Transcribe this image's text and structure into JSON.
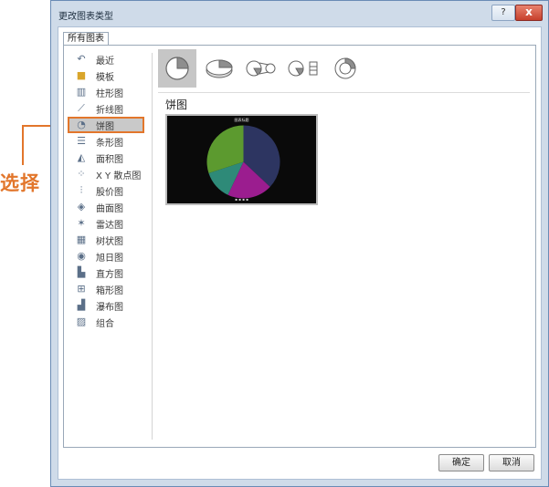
{
  "annotation": {
    "text": "选择",
    "color": "#e2762b"
  },
  "window": {
    "title": "更改图表类型",
    "help_glyph": "?",
    "close_glyph": "x"
  },
  "tab": {
    "label": "所有图表"
  },
  "sidebar": {
    "items": [
      {
        "label": "最近",
        "icon": "recent-icon"
      },
      {
        "label": "模板",
        "icon": "folder-icon"
      },
      {
        "label": "柱形图",
        "icon": "column-chart-icon"
      },
      {
        "label": "折线图",
        "icon": "line-chart-icon"
      },
      {
        "label": "饼图",
        "icon": "pie-chart-icon",
        "selected": true
      },
      {
        "label": "条形图",
        "icon": "bar-chart-icon"
      },
      {
        "label": "面积图",
        "icon": "area-chart-icon"
      },
      {
        "label": "X Y 散点图",
        "icon": "scatter-chart-icon"
      },
      {
        "label": "股价图",
        "icon": "stock-chart-icon"
      },
      {
        "label": "曲面图",
        "icon": "surface-chart-icon"
      },
      {
        "label": "雷达图",
        "icon": "radar-chart-icon"
      },
      {
        "label": "树状图",
        "icon": "treemap-chart-icon"
      },
      {
        "label": "旭日图",
        "icon": "sunburst-chart-icon"
      },
      {
        "label": "直方图",
        "icon": "histogram-chart-icon"
      },
      {
        "label": "箱形图",
        "icon": "box-whisker-chart-icon"
      },
      {
        "label": "瀑布图",
        "icon": "waterfall-chart-icon"
      },
      {
        "label": "组合",
        "icon": "combo-chart-icon"
      }
    ]
  },
  "main": {
    "subtypes": [
      "pie-icon",
      "3d-pie-icon",
      "pie-of-pie-icon",
      "bar-of-pie-icon",
      "doughnut-icon"
    ],
    "section_title": "饼图"
  },
  "preview_chart": {
    "title": "图表标题",
    "slices": [
      {
        "color": "#2d3561",
        "value": 37
      },
      {
        "color": "#9b1d8f",
        "value": 20
      },
      {
        "color": "#2e8a78",
        "value": 13
      },
      {
        "color": "#5c9a2f",
        "value": 30
      }
    ]
  },
  "buttons": {
    "ok": "确定",
    "cancel": "取消"
  },
  "colors": {
    "accent": "#e2762b",
    "frame": "#cfdbe9"
  }
}
